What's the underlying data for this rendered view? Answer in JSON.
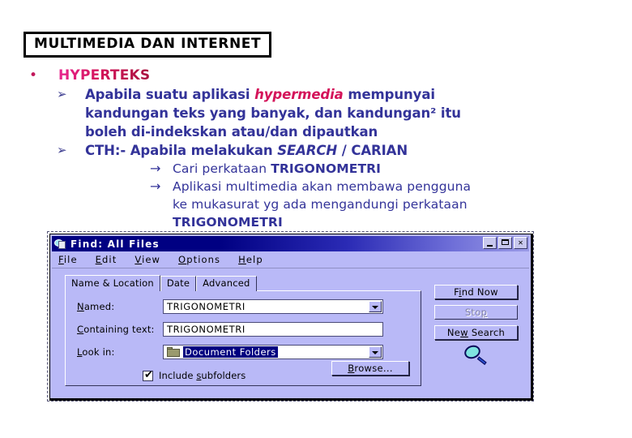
{
  "slide": {
    "title": "MULTIMEDIA DAN INTERNET",
    "bullet_marker": "•",
    "level2_marker": "➢",
    "level3_marker": "→",
    "heading": "HYPERTEKS",
    "items": [
      {
        "marker": "➢",
        "parts": [
          {
            "text": "Apabila suatu aplikasi ",
            "style": "normal"
          },
          {
            "text": "hypermedia",
            "style": "highlight-italic"
          },
          {
            "text": " mempunyai",
            "style": "normal"
          }
        ],
        "continuation": [
          "kandungan teks yang banyak, dan kandungan² itu",
          "boleh di-indekskan atau/dan dipautkan"
        ]
      },
      {
        "marker": "➢",
        "parts": [
          {
            "text": "CTH:- Apabila melakukan ",
            "style": "normal"
          },
          {
            "text": "SEARCH",
            "style": "italic"
          },
          {
            "text": " / CARIAN",
            "style": "normal"
          }
        ],
        "continuation": []
      }
    ],
    "sub_items": [
      {
        "marker": "→",
        "lines": [
          [
            {
              "text": "Cari perkataan ",
              "style": "normal"
            },
            {
              "text": "TRIGONOMETRI",
              "style": "bold"
            }
          ]
        ]
      },
      {
        "marker": "→",
        "lines": [
          [
            {
              "text": "Aplikasi multimedia akan membawa pengguna",
              "style": "normal"
            }
          ],
          [
            {
              "text": "ke mukasurat yg ada mengandungi perkataan",
              "style": "normal"
            }
          ],
          [
            {
              "text": "TRIGONOMETRI",
              "style": "bold"
            }
          ]
        ]
      }
    ]
  },
  "find_dialog": {
    "titlebar": {
      "title": "Find: All Files",
      "icon": "find-magnifier-icon",
      "minimize_label": "_",
      "maximize_label": "□",
      "close_label": "✕"
    },
    "menu": [
      {
        "accel": "F",
        "rest": "ile"
      },
      {
        "accel": "E",
        "rest": "dit"
      },
      {
        "accel": "V",
        "rest": "iew"
      },
      {
        "accel": "O",
        "rest": "ptions"
      },
      {
        "accel": "H",
        "rest": "elp"
      }
    ],
    "tabs": [
      {
        "label": "Name & Location",
        "active": true
      },
      {
        "label": "Date",
        "active": false
      },
      {
        "label": "Advanced",
        "active": false
      }
    ],
    "fields": {
      "named": {
        "accel": "N",
        "rest": "amed:",
        "value": "TRIGONOMETRI",
        "has_dropdown": true
      },
      "containing": {
        "accel": "C",
        "rest": "ontaining text:",
        "value": "TRIGONOMETRI",
        "has_dropdown": false
      },
      "lookin": {
        "accel": "L",
        "rest": "ook in:",
        "value": "Document Folders",
        "has_dropdown": true,
        "icon": "folder-icon",
        "selected": true
      }
    },
    "include_subfolders": {
      "pre": "Include ",
      "accel": "s",
      "post": "ubfolders",
      "checked": true,
      "tick": "✔"
    },
    "browse_button": {
      "accel": "B",
      "rest": "rowse..."
    },
    "buttons": [
      {
        "pre": "F",
        "accel": "i",
        "post": "nd Now",
        "disabled": false
      },
      {
        "pre": "Sto",
        "accel": "p",
        "post": "",
        "disabled": true
      },
      {
        "pre": "Ne",
        "accel": "w",
        "post": " Search",
        "disabled": false
      }
    ],
    "magnifier_icon": "magnifier-icon"
  },
  "colors": {
    "title_text": "#000000",
    "heading_pink": "#d4145a",
    "body_blue": "#333399",
    "dialog_face": "#b9b9f7",
    "titlebar_blue": "#000082",
    "selection_navy": "#000080",
    "folder_olive": "#9a9a6e",
    "lens_cyan": "#7fe3e0"
  }
}
